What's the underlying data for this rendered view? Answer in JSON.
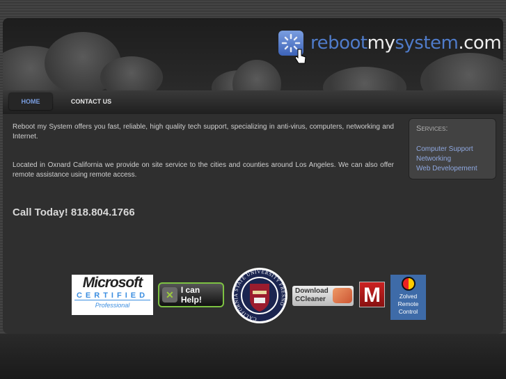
{
  "logo": {
    "part1": "reboot",
    "part2": "my",
    "part3": "system",
    ".com": ".com"
  },
  "nav": {
    "items": [
      {
        "label": "HOME",
        "active": true
      },
      {
        "label": "CONTACT US",
        "active": false
      }
    ]
  },
  "main": {
    "paragraph1": "Reboot my System offers you fast, reliable, high quality tech support, specializing in anti-virus, computers, networking and Internet.",
    "paragraph2": "Located in Oxnard California we provide on site service to the cities and counties around Los Angeles.  We can also offer remote assistance using remote access.",
    "call": "Call Today!  818.804.1766"
  },
  "services": {
    "title": "Services:",
    "links": [
      "Computer Support",
      "Networking",
      "Web Developement"
    ]
  },
  "badges": {
    "microsoft": {
      "line1": "Microsoft",
      "line2": "CERTIFIED",
      "line3": "Professional"
    },
    "icanhelp": "I can Help!",
    "csu": "CALIFORNIA STATE UNIVERSITY FRESNO",
    "ccleaner": {
      "line1": "Download",
      "line2": "CCleaner"
    },
    "malwarebytes": "M",
    "zolved": "Zolved Remote Control"
  },
  "colors": {
    "accent": "#4f7bc9",
    "link": "#8fa8e0"
  }
}
